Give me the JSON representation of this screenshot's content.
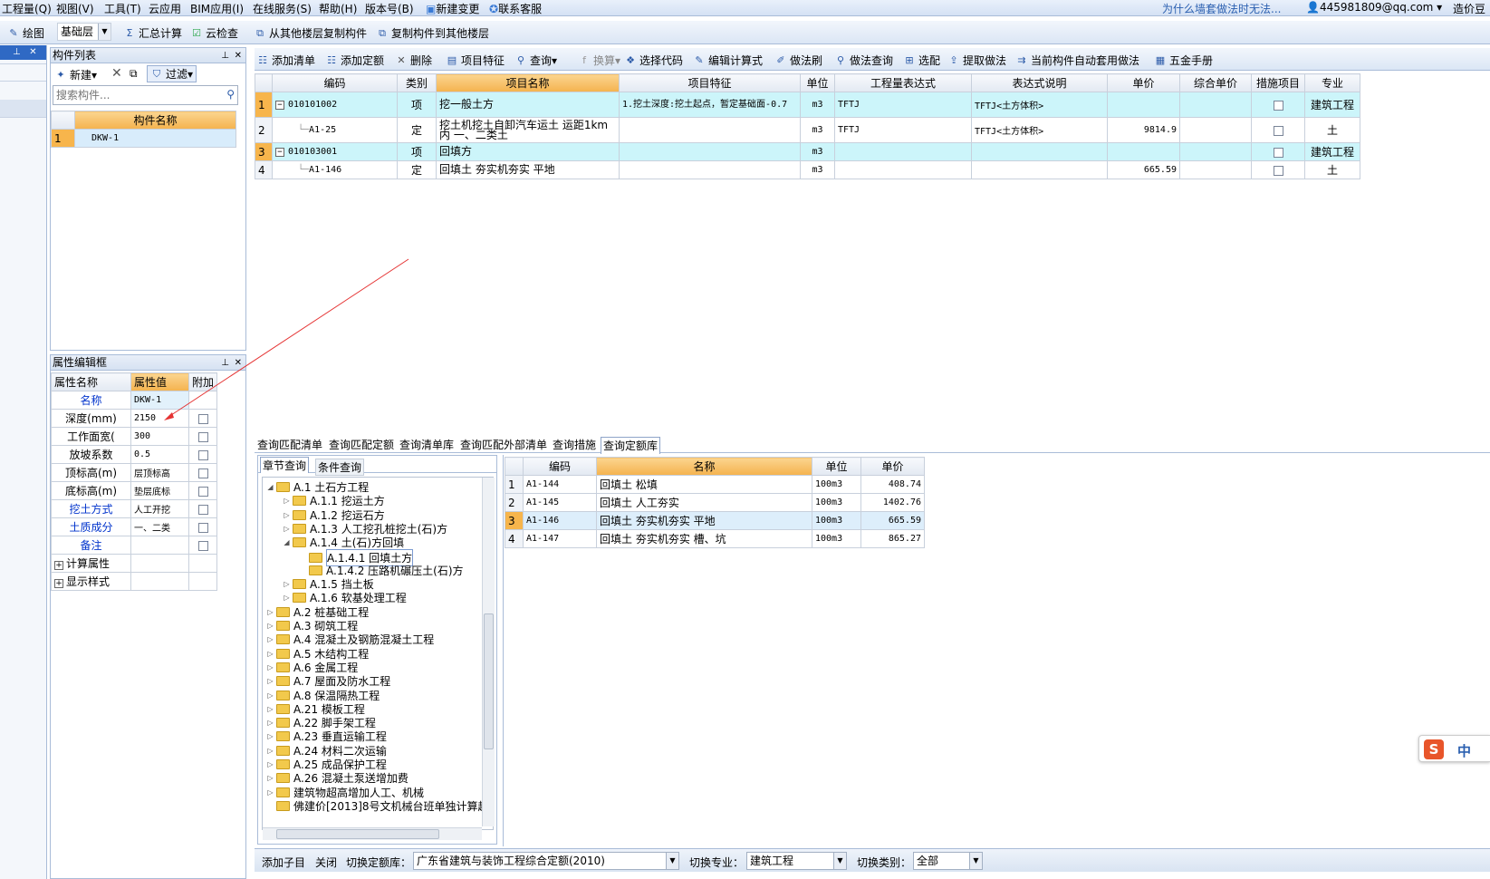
{
  "menu": [
    "工程量(Q)",
    "视图(V)",
    "工具(T)",
    "云应用",
    "BIM应用(I)",
    "在线服务(S)",
    "帮助(H)",
    "版本号(B)",
    "新建变更",
    "联系客服"
  ],
  "header_right": {
    "notice": "为什么墙套做法时无法...",
    "user": "445981809@qq.com ▾",
    "extra": "造价豆"
  },
  "toolbar1": {
    "draw": "绘图",
    "layer": "基础层",
    "summary": "汇总计算",
    "cloud_check": "云检查",
    "copy_from": "从其他楼层复制构件",
    "copy_to": "复制构件到其他楼层"
  },
  "component_list": {
    "title": "构件列表",
    "new": "新建▾",
    "filter": "过滤▾",
    "search_placeholder": "搜索构件...",
    "col": "构件名称",
    "rows": [
      {
        "n": "1",
        "name": "DKW-1"
      }
    ]
  },
  "property_editor": {
    "title": "属性编辑框",
    "cols": [
      "属性名称",
      "属性值",
      "附加"
    ],
    "rows": [
      {
        "name": "名称",
        "value": "DKW-1",
        "blue": true,
        "cb": false
      },
      {
        "name": "深度(mm)",
        "value": "2150",
        "blue": false,
        "cb": true
      },
      {
        "name": "工作面宽(",
        "value": "300",
        "blue": false,
        "cb": true
      },
      {
        "name": "放坡系数",
        "value": "0.5",
        "blue": false,
        "cb": true
      },
      {
        "name": "顶标高(m)",
        "value": "层顶标高",
        "blue": false,
        "cb": true
      },
      {
        "name": "底标高(m)",
        "value": "垫层底标",
        "blue": false,
        "cb": true
      },
      {
        "name": "挖土方式",
        "value": "人工开挖",
        "blue": true,
        "cb": true
      },
      {
        "name": "土质成分",
        "value": "一、二类",
        "blue": true,
        "cb": true
      },
      {
        "name": "备注",
        "value": "",
        "blue": true,
        "cb": true
      },
      {
        "name": "计算属性",
        "value": "",
        "blue": false,
        "cb": false,
        "plus": true
      },
      {
        "name": "显示样式",
        "value": "",
        "blue": false,
        "cb": false,
        "plus": true
      }
    ]
  },
  "toolbar2": [
    "添加清单",
    "添加定额",
    "删除",
    "项目特征",
    "查询▾",
    "换算▾",
    "选择代码",
    "编辑计算式",
    "做法刷",
    "做法查询",
    "选配",
    "提取做法",
    "当前构件自动套用做法",
    "五金手册"
  ],
  "main_table": {
    "cols": [
      "编码",
      "类别",
      "项目名称",
      "项目特征",
      "单位",
      "工程量表达式",
      "表达式说明",
      "单价",
      "综合单价",
      "措施项目",
      "专业"
    ],
    "rows": [
      {
        "n": "1",
        "code": "010101002",
        "type": "项",
        "name": "挖一般土方",
        "feature": "1.挖土深度:挖土起点，暂定基础面-0.7",
        "unit": "m3",
        "expr": "TFTJ",
        "desc": "TFTJ<土方体积>",
        "price": "",
        "cprice": "",
        "spec": "建筑工程",
        "hl": true,
        "child": false
      },
      {
        "n": "2",
        "code": "A1-25",
        "type": "定",
        "name": "挖土机挖土自卸汽车运土 运距1km内 一、二类土",
        "feature": "",
        "unit": "m3",
        "expr": "TFTJ",
        "desc": "TFTJ<土方体积>",
        "price": "9814.9",
        "cprice": "",
        "spec": "土",
        "hl": false,
        "child": true
      },
      {
        "n": "3",
        "code": "010103001",
        "type": "项",
        "name": "回填方",
        "feature": "",
        "unit": "m3",
        "expr": "",
        "desc": "",
        "price": "",
        "cprice": "",
        "spec": "建筑工程",
        "hl": true,
        "child": false
      },
      {
        "n": "4",
        "code": "A1-146",
        "type": "定",
        "name": "回填土 夯实机夯实 平地",
        "feature": "",
        "unit": "m3",
        "expr": "",
        "desc": "",
        "price": "665.59",
        "cprice": "",
        "spec": "土",
        "hl": false,
        "child": true
      }
    ]
  },
  "bottom_tabs": [
    "查询匹配清单",
    "查询匹配定额",
    "查询清单库",
    "查询匹配外部清单",
    "查询措施",
    "查询定额库"
  ],
  "tree_tabs": [
    "章节查询",
    "条件查询"
  ],
  "tree": [
    {
      "d": 0,
      "a": "◢",
      "t": "A.1 土石方工程"
    },
    {
      "d": 1,
      "a": "▷",
      "t": "A.1.1 挖运土方"
    },
    {
      "d": 1,
      "a": "▷",
      "t": "A.1.2 挖运石方"
    },
    {
      "d": 1,
      "a": "▷",
      "t": "A.1.3 人工挖孔桩挖土(石)方"
    },
    {
      "d": 1,
      "a": "◢",
      "t": "A.1.4 土(石)方回填"
    },
    {
      "d": 2,
      "a": "",
      "t": "A.1.4.1 回填土方",
      "sel": true
    },
    {
      "d": 2,
      "a": "",
      "t": "A.1.4.2 压路机碾压土(石)方"
    },
    {
      "d": 1,
      "a": "▷",
      "t": "A.1.5 挡土板"
    },
    {
      "d": 1,
      "a": "▷",
      "t": "A.1.6 软基处理工程"
    },
    {
      "d": 0,
      "a": "▷",
      "t": "A.2 桩基础工程"
    },
    {
      "d": 0,
      "a": "▷",
      "t": "A.3 砌筑工程"
    },
    {
      "d": 0,
      "a": "▷",
      "t": "A.4 混凝土及钢筋混凝土工程"
    },
    {
      "d": 0,
      "a": "▷",
      "t": "A.5 木结构工程"
    },
    {
      "d": 0,
      "a": "▷",
      "t": "A.6 金属工程"
    },
    {
      "d": 0,
      "a": "▷",
      "t": "A.7 屋面及防水工程"
    },
    {
      "d": 0,
      "a": "▷",
      "t": "A.8 保温隔热工程"
    },
    {
      "d": 0,
      "a": "▷",
      "t": "A.21 模板工程"
    },
    {
      "d": 0,
      "a": "▷",
      "t": "A.22 脚手架工程"
    },
    {
      "d": 0,
      "a": "▷",
      "t": "A.23 垂直运输工程"
    },
    {
      "d": 0,
      "a": "▷",
      "t": "A.24 材料二次运输"
    },
    {
      "d": 0,
      "a": "▷",
      "t": "A.25 成品保护工程"
    },
    {
      "d": 0,
      "a": "▷",
      "t": "A.26 混凝土泵送增加费"
    },
    {
      "d": 0,
      "a": "▷",
      "t": "建筑物超高增加人工、机械"
    },
    {
      "d": 0,
      "a": "",
      "t": "佛建价[2013]8号文机械台班单独计算超"
    }
  ],
  "quota_table": {
    "cols": [
      "编码",
      "名称",
      "单位",
      "单价"
    ],
    "rows": [
      {
        "n": "1",
        "code": "A1-144",
        "name": "回填土 松填",
        "unit": "100m3",
        "price": "408.74"
      },
      {
        "n": "2",
        "code": "A1-145",
        "name": "回填土 人工夯实",
        "unit": "100m3",
        "price": "1402.76"
      },
      {
        "n": "3",
        "code": "A1-146",
        "name": "回填土 夯实机夯实 平地",
        "unit": "100m3",
        "price": "665.59",
        "sel": true
      },
      {
        "n": "4",
        "code": "A1-147",
        "name": "回填土 夯实机夯实 槽、坑",
        "unit": "100m3",
        "price": "865.27"
      }
    ]
  },
  "bottom_bar": {
    "add_child": "添加子目",
    "close": "关闭",
    "switch_lib": "切换定额库：",
    "lib_value": "广东省建筑与装饰工程综合定额(2010)",
    "switch_spec": "切换专业：",
    "spec_value": "建筑工程",
    "switch_type": "切换类别：",
    "type_value": "全部"
  },
  "ime": {
    "logo": "S",
    "lang": "中"
  },
  "colors": {
    "accent_orange": "#f4b24e",
    "row_highlight": "#ccf5fa",
    "annotation_line": "#e53333"
  }
}
